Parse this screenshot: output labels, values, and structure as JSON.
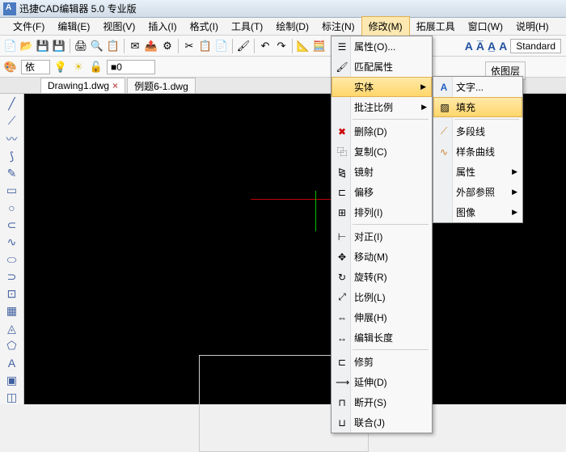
{
  "title": "迅捷CAD编辑器 5.0 专业版",
  "menu": {
    "file": "文件(F)",
    "edit": "编辑(E)",
    "view": "视图(V)",
    "insert": "插入(I)",
    "format": "格式(I)",
    "tool": "工具(T)",
    "draw": "绘制(D)",
    "annot": "标注(N)",
    "modify": "修改(M)",
    "ext": "拓展工具",
    "window": "窗口(W)",
    "help": "说明(H)"
  },
  "combo": {
    "color": "依",
    "zero": "0"
  },
  "tabs": {
    "t1": "Drawing1.dwg",
    "t2": "例题6-1.dwg"
  },
  "right": {
    "std": "Standard"
  },
  "layer": "依图层",
  "dd1": {
    "prop": "属性(O)...",
    "match": "匹配属性",
    "entity": "实体",
    "annoscale": "批注比例",
    "del": "删除(D)",
    "copy": "复制(C)",
    "mirror": "镜射",
    "offset": "偏移",
    "array": "排列(I)",
    "align": "对正(I)",
    "move": "移动(M)",
    "rotate": "旋转(R)",
    "scale": "比例(L)",
    "extend": "伸展(H)",
    "length": "编辑长度",
    "trim": "修剪",
    "extend2": "延伸(D)",
    "break": "断开(S)",
    "join": "联合(J)"
  },
  "dd2": {
    "text": "文字...",
    "fill": "填充",
    "pline": "多段线",
    "spline": "样条曲线",
    "attr": "属性",
    "xref": "外部参照",
    "image": "图像"
  }
}
